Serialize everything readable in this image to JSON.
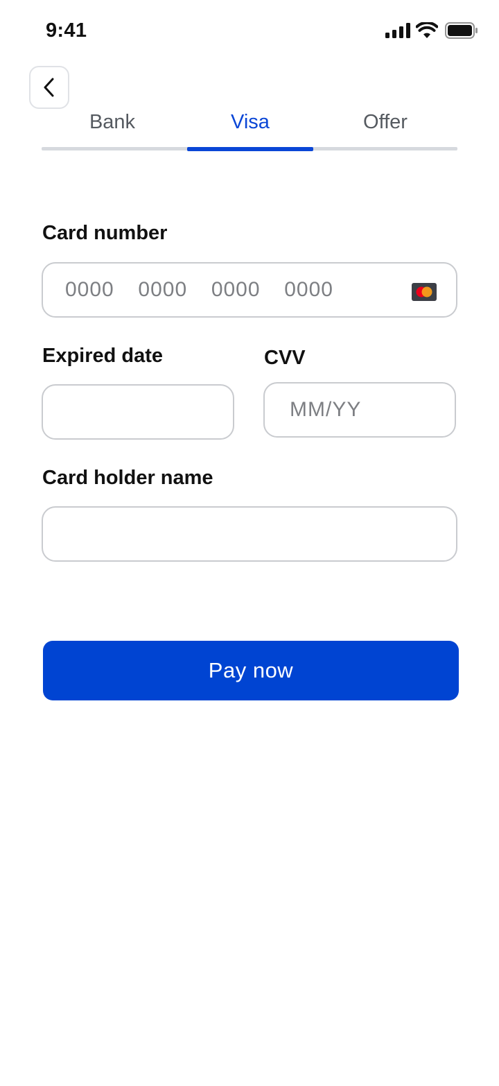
{
  "status_bar": {
    "time": "9:41",
    "icons": [
      "signal-icon",
      "wifi-icon",
      "battery-icon"
    ]
  },
  "header": {
    "back_icon": "chevron-left-icon"
  },
  "tabs": [
    {
      "label": "Bank",
      "active": false
    },
    {
      "label": "Visa",
      "active": true
    },
    {
      "label": "Offer",
      "active": false
    }
  ],
  "form": {
    "card_number": {
      "label": "Card number",
      "value": "",
      "placeholder": "0000  0000  0000  0000",
      "brand_icon": "mastercard-icon"
    },
    "expiry": {
      "label": "Expired date",
      "value": "",
      "placeholder": ""
    },
    "cvv": {
      "label": "CVV",
      "value": "",
      "placeholder": "MM/YY"
    },
    "holder_name": {
      "label": "Card holder name",
      "value": "",
      "placeholder": ""
    }
  },
  "pay_button": {
    "label": "Pay now"
  },
  "colors": {
    "accent": "#0044D2",
    "tab_active": "#0A46D6",
    "tab_inactive": "#555A60",
    "field_border": "#C9CBCF",
    "mastercard_red": "#EB001B",
    "mastercard_orange": "#F79E1B"
  }
}
